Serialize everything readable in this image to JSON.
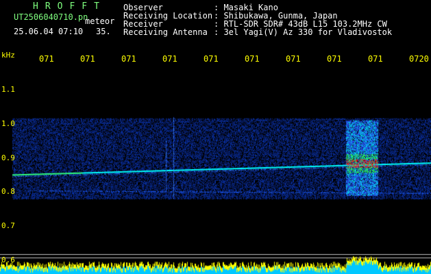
{
  "header": {
    "brand": "HROFFT",
    "filename": "UT2506040710.pn",
    "datetime": "25.06.04 07:10",
    "detection": "meteor",
    "count": "35.",
    "fields": [
      {
        "label": "Observer",
        "value": ": Masaki Kano"
      },
      {
        "label": "Receiving Location",
        "value": ": Shibukawa, Gunma, Japan"
      },
      {
        "label": "Receiver",
        "value": ": RTL-SDR SDR# 43dB L15 103.2MHz CW"
      },
      {
        "label": "Receiving Antenna",
        "value": ": 3el Yagi(V) Az 330 for Vladivostok"
      }
    ]
  },
  "chart_data": {
    "type": "heatmap",
    "ylabel": "kHz",
    "y_ticks": [
      "1.1",
      "1.0",
      "0.9",
      "0.8",
      "0.7",
      "0.6"
    ],
    "x_ticks": [
      "071",
      "071",
      "071",
      "071",
      "071",
      "071",
      "071",
      "071",
      "071",
      "0720"
    ],
    "ylim": [
      0.6,
      1.1
    ],
    "carrier_khz": 0.87,
    "colors": {
      "background": "#000000",
      "noise": "#1a2fd9",
      "signal": "#00ffff",
      "peak": "#ff2020",
      "level_trace": "#ffff00",
      "level_fill": "#00c8ff"
    }
  }
}
